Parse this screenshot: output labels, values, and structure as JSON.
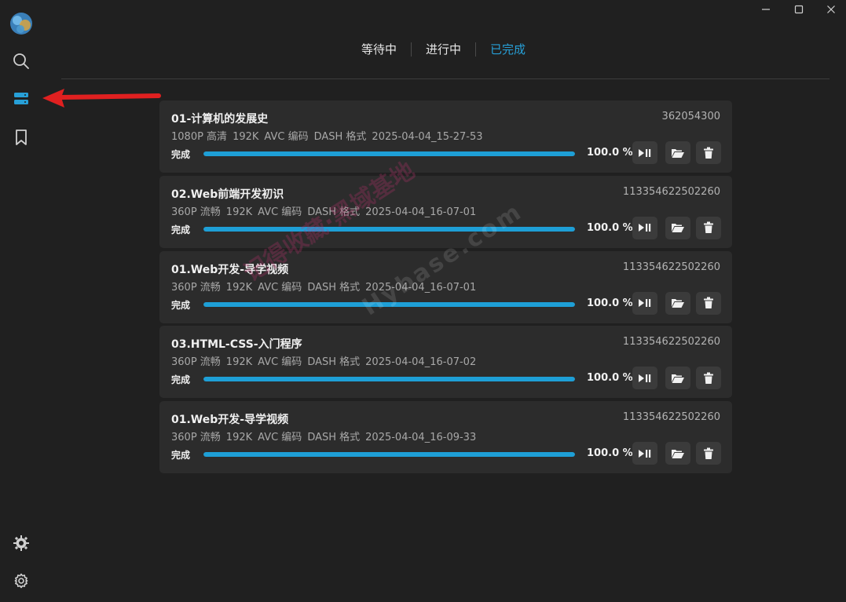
{
  "window": {
    "minimize_icon": "minimize-icon",
    "maximize_icon": "maximize-icon",
    "close_icon": "close-icon"
  },
  "sidebar": {
    "items": [
      {
        "name": "search",
        "icon": "search-icon"
      },
      {
        "name": "downloads",
        "icon": "server-list-icon",
        "active": true
      },
      {
        "name": "bookmarks",
        "icon": "bookmark-icon"
      },
      {
        "name": "theme",
        "icon": "sun-gear-icon"
      },
      {
        "name": "settings",
        "icon": "gear-icon"
      }
    ]
  },
  "tabs": [
    {
      "label": "等待中",
      "active": false
    },
    {
      "label": "进行中",
      "active": false
    },
    {
      "label": "已完成",
      "active": true
    }
  ],
  "downloads": [
    {
      "title": "01-计算机的发展史",
      "id": "362054300",
      "quality": "1080P 高清",
      "audio": "192K",
      "codec": "AVC 编码",
      "format": "DASH 格式",
      "time": "2025-04-04_15-27-53",
      "status": "完成",
      "percent_text": "100.0 %",
      "progress": 100
    },
    {
      "title": "02.Web前端开发初识",
      "id": "113354622502260",
      "quality": "360P 流畅",
      "audio": "192K",
      "codec": "AVC 编码",
      "format": "DASH 格式",
      "time": "2025-04-04_16-07-01",
      "status": "完成",
      "percent_text": "100.0 %",
      "progress": 100
    },
    {
      "title": "01.Web开发-导学视频",
      "id": "113354622502260",
      "quality": "360P 流畅",
      "audio": "192K",
      "codec": "AVC 编码",
      "format": "DASH 格式",
      "time": "2025-04-04_16-07-01",
      "status": "完成",
      "percent_text": "100.0 %",
      "progress": 100
    },
    {
      "title": "03.HTML-CSS-入门程序",
      "id": "113354622502260",
      "quality": "360P 流畅",
      "audio": "192K",
      "codec": "AVC 编码",
      "format": "DASH 格式",
      "time": "2025-04-04_16-07-02",
      "status": "完成",
      "percent_text": "100.0 %",
      "progress": 100
    },
    {
      "title": "01.Web开发-导学视频",
      "id": "113354622502260",
      "quality": "360P 流畅",
      "audio": "192K",
      "codec": "AVC 编码",
      "format": "DASH 格式",
      "time": "2025-04-04_16-09-33",
      "status": "完成",
      "percent_text": "100.0 %",
      "progress": 100
    }
  ],
  "watermark": {
    "text": "记得收藏·黑域基地",
    "site": "Hybase.com"
  },
  "colors": {
    "accent": "#1e9fd6",
    "active_tab": "#27a0d8",
    "annotation_arrow": "#e02020"
  }
}
